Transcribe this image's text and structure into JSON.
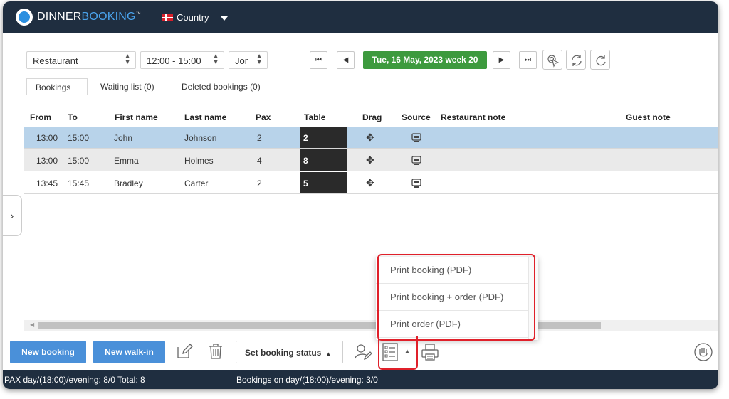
{
  "header": {
    "logo_bold": "DINNER",
    "logo_color": "BOOKING",
    "logo_tm": "™",
    "country_label": "Country"
  },
  "toolbar": {
    "restaurant_select": "Restaurant",
    "time_select": "12:00 - 15:00",
    "third_select": "Jor",
    "date_label": "Tue, 16 May, 2023 week 20",
    "first_icon": "⏮",
    "prev_icon": "◀",
    "next_icon": "▶",
    "last_icon": "⏭"
  },
  "tabs": [
    {
      "label": "Bookings",
      "active": true
    },
    {
      "label": "Waiting list (0)",
      "active": false
    },
    {
      "label": "Deleted bookings (0)",
      "active": false
    }
  ],
  "columns": {
    "from": "From",
    "to": "To",
    "first_name": "First name",
    "last_name": "Last name",
    "pax": "Pax",
    "table": "Table",
    "drag": "Drag",
    "source": "Source",
    "restaurant_note": "Restaurant note",
    "guest_note": "Guest note"
  },
  "rows": [
    {
      "from": "13:00",
      "to": "15:00",
      "first": "John",
      "last": "Johnson",
      "pax": "2",
      "table": "2"
    },
    {
      "from": "13:00",
      "to": "15:00",
      "first": "Emma",
      "last": "Holmes",
      "pax": "4",
      "table": "8"
    },
    {
      "from": "13:45",
      "to": "15:45",
      "first": "Bradley",
      "last": "Carter",
      "pax": "2",
      "table": "5"
    }
  ],
  "print_menu": {
    "items": [
      "Print booking (PDF)",
      "Print booking + order (PDF)",
      "Print order (PDF)"
    ]
  },
  "bottom": {
    "new_booking": "New booking",
    "new_walkin": "New walk-in",
    "set_status": "Set booking status"
  },
  "status": {
    "pax": "PAX day/(18:00)/evening: 8/0 Total: 8",
    "bookings": "Bookings on day/(18:00)/evening: 3/0"
  },
  "colors": {
    "topbar": "#1f2e40",
    "date_green": "#3d9a3e",
    "button_blue": "#4a90d9",
    "selected_row": "#b8d3ea",
    "highlight_red": "#e0202a"
  },
  "icons": [
    "logo-icon",
    "denmark-flag-icon",
    "chevron-down-icon",
    "double-left-icon",
    "left-icon",
    "right-icon",
    "double-right-icon",
    "touch-icon",
    "refresh-icon",
    "reload-icon",
    "move-icon",
    "computer-icon",
    "edit-icon",
    "trash-icon",
    "user-edit-icon",
    "list-icon",
    "printer-icon",
    "hand-icon",
    "chevron-right-icon"
  ]
}
